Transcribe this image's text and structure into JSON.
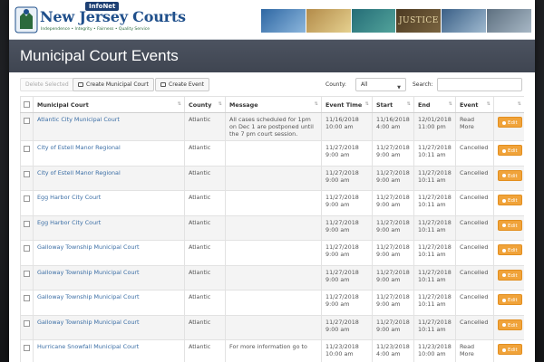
{
  "banner": {
    "brand_name": "New Jersey Courts",
    "tagline": "Independence • Integrity • Fairness • Quality Service",
    "infonet": "InfoNet",
    "justice": "JUSTICE"
  },
  "page_title": "Municipal Court Events",
  "toolbar": {
    "delete_label": "Delete Selected",
    "create_court_label": "Create Municipal Court",
    "create_event_label": "Create Event",
    "county_label": "County:",
    "county_value": "All",
    "search_label": "Search:",
    "search_value": ""
  },
  "table": {
    "headers": {
      "court": "Municipal Court",
      "county": "County",
      "message": "Message",
      "event_time": "Event Time",
      "start": "Start",
      "end": "End",
      "event": "Event"
    },
    "edit_label": "Edit",
    "rows": [
      {
        "court": "Atlantic City Municipal Court",
        "county": "Atlantic",
        "message": "All cases scheduled for 1pm on Dec 1 are postponed until the 7 pm court session.",
        "event_time": "11/16/2018 10:00 am",
        "start": "11/16/2018 4:00 am",
        "end": "12/01/2018 11:00 pm",
        "event": "Read More"
      },
      {
        "court": "City of Estell Manor Regional",
        "county": "Atlantic",
        "message": "",
        "event_time": "11/27/2018 9:00 am",
        "start": "11/27/2018 9:00 am",
        "end": "11/27/2018 10:11 am",
        "event": "Cancelled"
      },
      {
        "court": "City of Estell Manor Regional",
        "county": "Atlantic",
        "message": "",
        "event_time": "11/27/2018 9:00 am",
        "start": "11/27/2018 9:00 am",
        "end": "11/27/2018 10:11 am",
        "event": "Cancelled"
      },
      {
        "court": "Egg Harbor City Court",
        "county": "Atlantic",
        "message": "",
        "event_time": "11/27/2018 9:00 am",
        "start": "11/27/2018 9:00 am",
        "end": "11/27/2018 10:11 am",
        "event": "Cancelled"
      },
      {
        "court": "Egg Harbor City Court",
        "county": "Atlantic",
        "message": "",
        "event_time": "11/27/2018 9:00 am",
        "start": "11/27/2018 9:00 am",
        "end": "11/27/2018 10:11 am",
        "event": "Cancelled"
      },
      {
        "court": "Galloway Township Municipal Court",
        "county": "Atlantic",
        "message": "",
        "event_time": "11/27/2018 9:00 am",
        "start": "11/27/2018 9:00 am",
        "end": "11/27/2018 10:11 am",
        "event": "Cancelled"
      },
      {
        "court": "Galloway Township Municipal Court",
        "county": "Atlantic",
        "message": "",
        "event_time": "11/27/2018 9:00 am",
        "start": "11/27/2018 9:00 am",
        "end": "11/27/2018 10:11 am",
        "event": "Cancelled"
      },
      {
        "court": "Galloway Township Municipal Court",
        "county": "Atlantic",
        "message": "",
        "event_time": "11/27/2018 9:00 am",
        "start": "11/27/2018 9:00 am",
        "end": "11/27/2018 10:11 am",
        "event": "Cancelled"
      },
      {
        "court": "Galloway Township Municipal Court",
        "county": "Atlantic",
        "message": "",
        "event_time": "11/27/2018 9:00 am",
        "start": "11/27/2018 9:00 am",
        "end": "11/27/2018 10:11 am",
        "event": "Cancelled"
      },
      {
        "court": "Hurricane Snowfall Municipal Court",
        "county": "Atlantic",
        "message": "For more information go to",
        "event_time": "11/23/2018 10:00 am",
        "start": "11/23/2018 4:00 am",
        "end": "11/23/2018 10:00 am",
        "event": "Read More"
      }
    ]
  },
  "colors": {
    "title_bar": "#434956",
    "link": "#3b6ea5",
    "edit_button": "#f0a33a"
  }
}
